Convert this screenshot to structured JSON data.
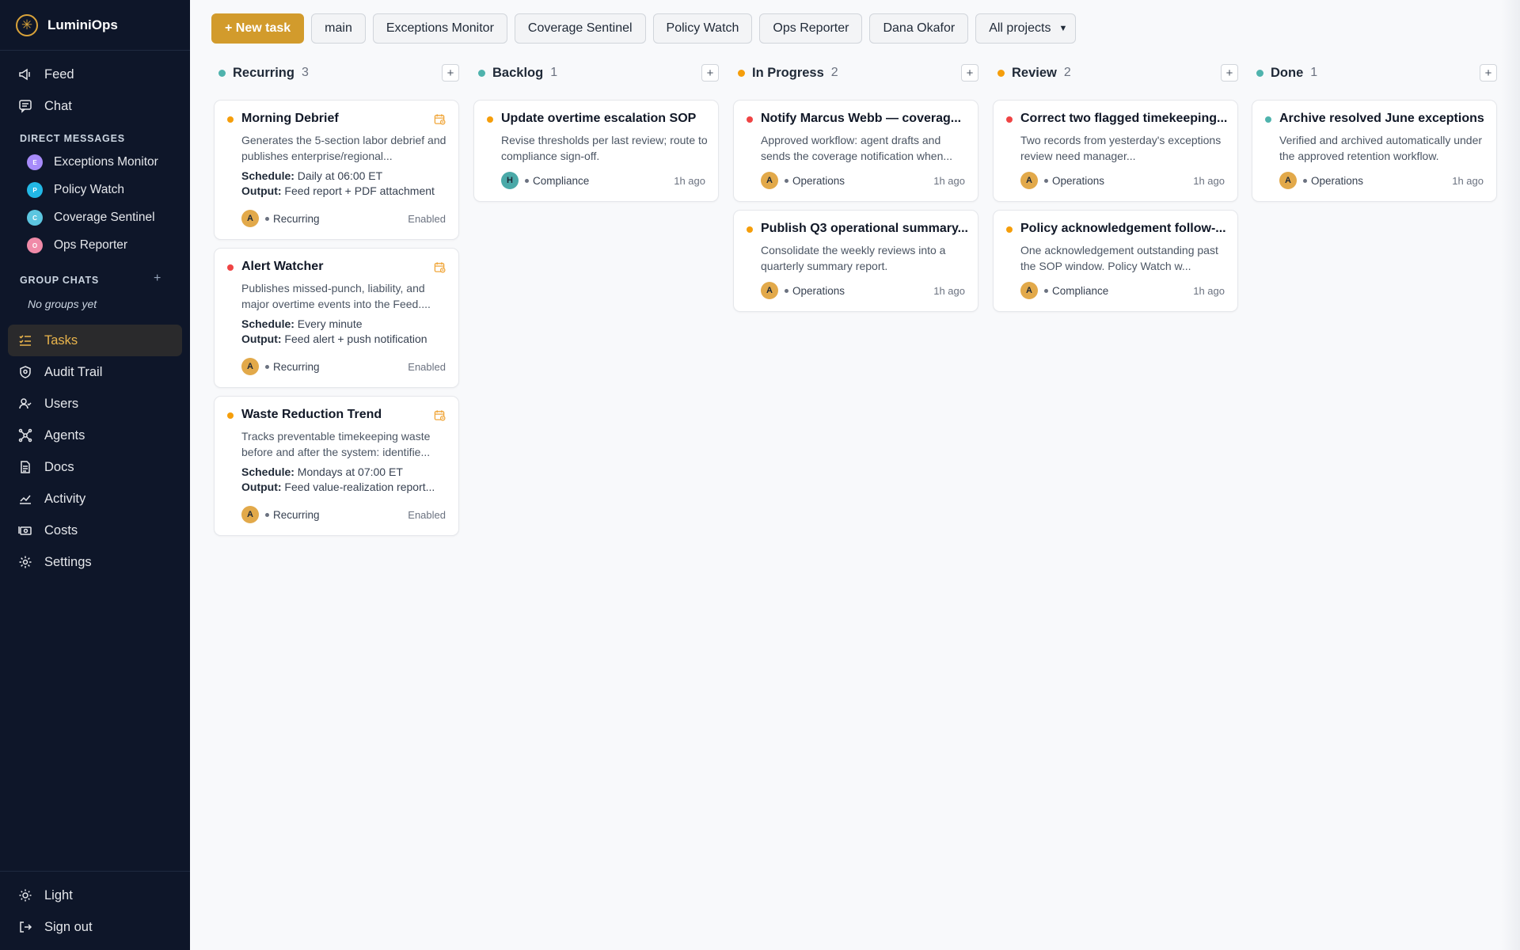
{
  "app": {
    "name": "LuminiOps"
  },
  "sidebar": {
    "nav_top": [
      {
        "label": "Feed",
        "icon": "megaphone-icon"
      },
      {
        "label": "Chat",
        "icon": "chat-icon"
      }
    ],
    "dm_label": "DIRECT MESSAGES",
    "dms": [
      {
        "label": "Exceptions Monitor",
        "initial": "E",
        "color": "#a78bfa"
      },
      {
        "label": "Policy Watch",
        "initial": "P",
        "color": "#22b8e6"
      },
      {
        "label": "Coverage Sentinel",
        "initial": "C",
        "color": "#5cc6e0"
      },
      {
        "label": "Ops Reporter",
        "initial": "O",
        "color": "#f08aa8"
      }
    ],
    "group_label": "GROUP CHATS",
    "group_add": "+",
    "no_groups": "No groups yet",
    "nav_main": [
      {
        "label": "Tasks",
        "icon": "tasks-icon",
        "active": true
      },
      {
        "label": "Audit Trail",
        "icon": "shield-icon"
      },
      {
        "label": "Users",
        "icon": "users-icon"
      },
      {
        "label": "Agents",
        "icon": "agents-icon"
      },
      {
        "label": "Docs",
        "icon": "document-icon"
      },
      {
        "label": "Activity",
        "icon": "activity-icon"
      },
      {
        "label": "Costs",
        "icon": "money-icon"
      },
      {
        "label": "Settings",
        "icon": "gear-icon"
      }
    ],
    "bottom": [
      {
        "label": "Light",
        "icon": "sun-icon"
      },
      {
        "label": "Sign out",
        "icon": "sign-out-icon"
      }
    ]
  },
  "toolbar": {
    "new_task": "+ New task",
    "filters": [
      "main",
      "Exceptions Monitor",
      "Coverage Sentinel",
      "Policy Watch",
      "Ops Reporter",
      "Dana Okafor"
    ],
    "project_select": "All projects"
  },
  "board": {
    "add_symbol": "+",
    "columns": [
      {
        "title": "Recurring",
        "count": "3",
        "dot": "#4fb3ad",
        "cards": [
          {
            "title": "Morning Debrief",
            "dot": "#f59e0b",
            "desc": "Generates the 5-section labor debrief and publishes enterprise/regional...",
            "schedule_label": "Schedule:",
            "schedule": "Daily at 06:00 ET",
            "output_label": "Output:",
            "output": "Feed report + PDF attachment",
            "avatar": "A",
            "tag": "Recurring",
            "status": "Enabled"
          },
          {
            "title": "Alert Watcher",
            "dot": "#ef4444",
            "desc": "Publishes missed-punch, liability, and major overtime events into the Feed....",
            "schedule_label": "Schedule:",
            "schedule": "Every minute",
            "output_label": "Output:",
            "output": "Feed alert + push notification",
            "avatar": "A",
            "tag": "Recurring",
            "status": "Enabled"
          },
          {
            "title": "Waste Reduction Trend",
            "dot": "#f59e0b",
            "desc": "Tracks preventable timekeeping waste before and after the system: identifie...",
            "schedule_label": "Schedule:",
            "schedule": "Mondays at 07:00 ET",
            "output_label": "Output:",
            "output": "Feed value-realization report...",
            "avatar": "A",
            "tag": "Recurring",
            "status": "Enabled"
          }
        ]
      },
      {
        "title": "Backlog",
        "count": "1",
        "dot": "#4fb3ad",
        "cards": [
          {
            "title": "Update overtime escalation SOP",
            "dot": "#f59e0b",
            "desc": "Revise thresholds per last review; route to compliance sign-off.",
            "avatar": "H",
            "tag": "Compliance",
            "time": "1h ago"
          }
        ]
      },
      {
        "title": "In Progress",
        "count": "2",
        "dot": "#f59e0b",
        "cards": [
          {
            "title": "Notify Marcus Webb — coverag...",
            "dot": "#ef4444",
            "desc": "Approved workflow: agent drafts and sends the coverage notification when...",
            "avatar": "A",
            "tag": "Operations",
            "time": "1h ago"
          },
          {
            "title": "Publish Q3 operational summary...",
            "dot": "#f59e0b",
            "desc": "Consolidate the weekly reviews into a quarterly summary report.",
            "avatar": "A",
            "tag": "Operations",
            "time": "1h ago"
          }
        ]
      },
      {
        "title": "Review",
        "count": "2",
        "dot": "#f59e0b",
        "cards": [
          {
            "title": "Correct two flagged timekeeping...",
            "dot": "#ef4444",
            "desc": "Two records from yesterday's exceptions review need manager...",
            "avatar": "A",
            "tag": "Operations",
            "time": "1h ago"
          },
          {
            "title": "Policy acknowledgement follow-...",
            "dot": "#f59e0b",
            "desc": "One acknowledgement outstanding past the SOP window. Policy Watch w...",
            "avatar": "A",
            "tag": "Compliance",
            "time": "1h ago"
          }
        ]
      },
      {
        "title": "Done",
        "count": "1",
        "dot": "#4fb3ad",
        "cards": [
          {
            "title": "Archive resolved June exceptions",
            "dot": "#4fb3ad",
            "desc": "Verified and archived automatically under the approved retention workflow.",
            "avatar": "A",
            "tag": "Operations",
            "time": "1h ago"
          }
        ]
      }
    ]
  }
}
